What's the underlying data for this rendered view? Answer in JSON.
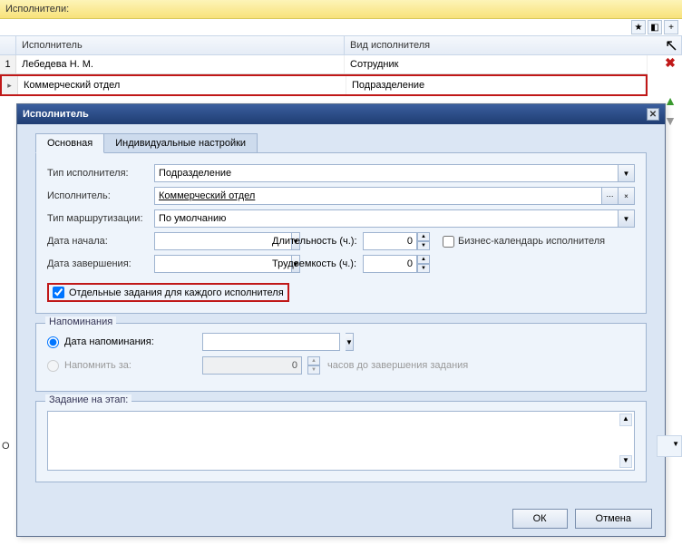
{
  "panel": {
    "title": "Исполнители:"
  },
  "toolbar": {
    "star": "star-icon",
    "refresh": "refresh-icon",
    "add": "add-icon"
  },
  "grid": {
    "headers": {
      "performer": "Исполнитель",
      "type": "Вид исполнителя"
    },
    "rows": [
      {
        "num": "1",
        "performer": "Лебедева Н. М.",
        "type": "Сотрудник"
      },
      {
        "num": "",
        "performer": "Коммерческий отдел",
        "type": "Подразделение"
      }
    ]
  },
  "side": {
    "delete": "✖",
    "up": "▲",
    "down": "▼"
  },
  "dialog": {
    "title": "Исполнитель",
    "tabs": {
      "main": "Основная",
      "custom": "Индивидуальные настройки"
    },
    "fields": {
      "perf_type_label": "Тип исполнителя:",
      "perf_type_value": "Подразделение",
      "performer_label": "Исполнитель:",
      "performer_value": "Коммерческий отдел",
      "route_type_label": "Тип маршрутизации:",
      "route_type_value": "По умолчанию",
      "start_date_label": "Дата начала:",
      "start_date_value": "",
      "duration_label": "Длительность (ч.):",
      "duration_value": "0",
      "biz_cal_label": "Бизнес-календарь исполнителя",
      "end_date_label": "Дата завершения:",
      "end_date_value": "",
      "labor_label": "Трудоемкость (ч.):",
      "labor_value": "0",
      "separate_tasks_label": "Отдельные задания для каждого исполнителя"
    },
    "reminders": {
      "legend": "Напоминания",
      "date_label": "Дата напоминания:",
      "date_value": "",
      "remind_label": "Напомнить за:",
      "remind_value": "0",
      "remind_suffix": "часов до завершения задания"
    },
    "stage": {
      "legend": "Задание на этап:"
    },
    "buttons": {
      "ok": "ОК",
      "cancel": "Отмена"
    }
  },
  "outside": {
    "letter": "О"
  }
}
